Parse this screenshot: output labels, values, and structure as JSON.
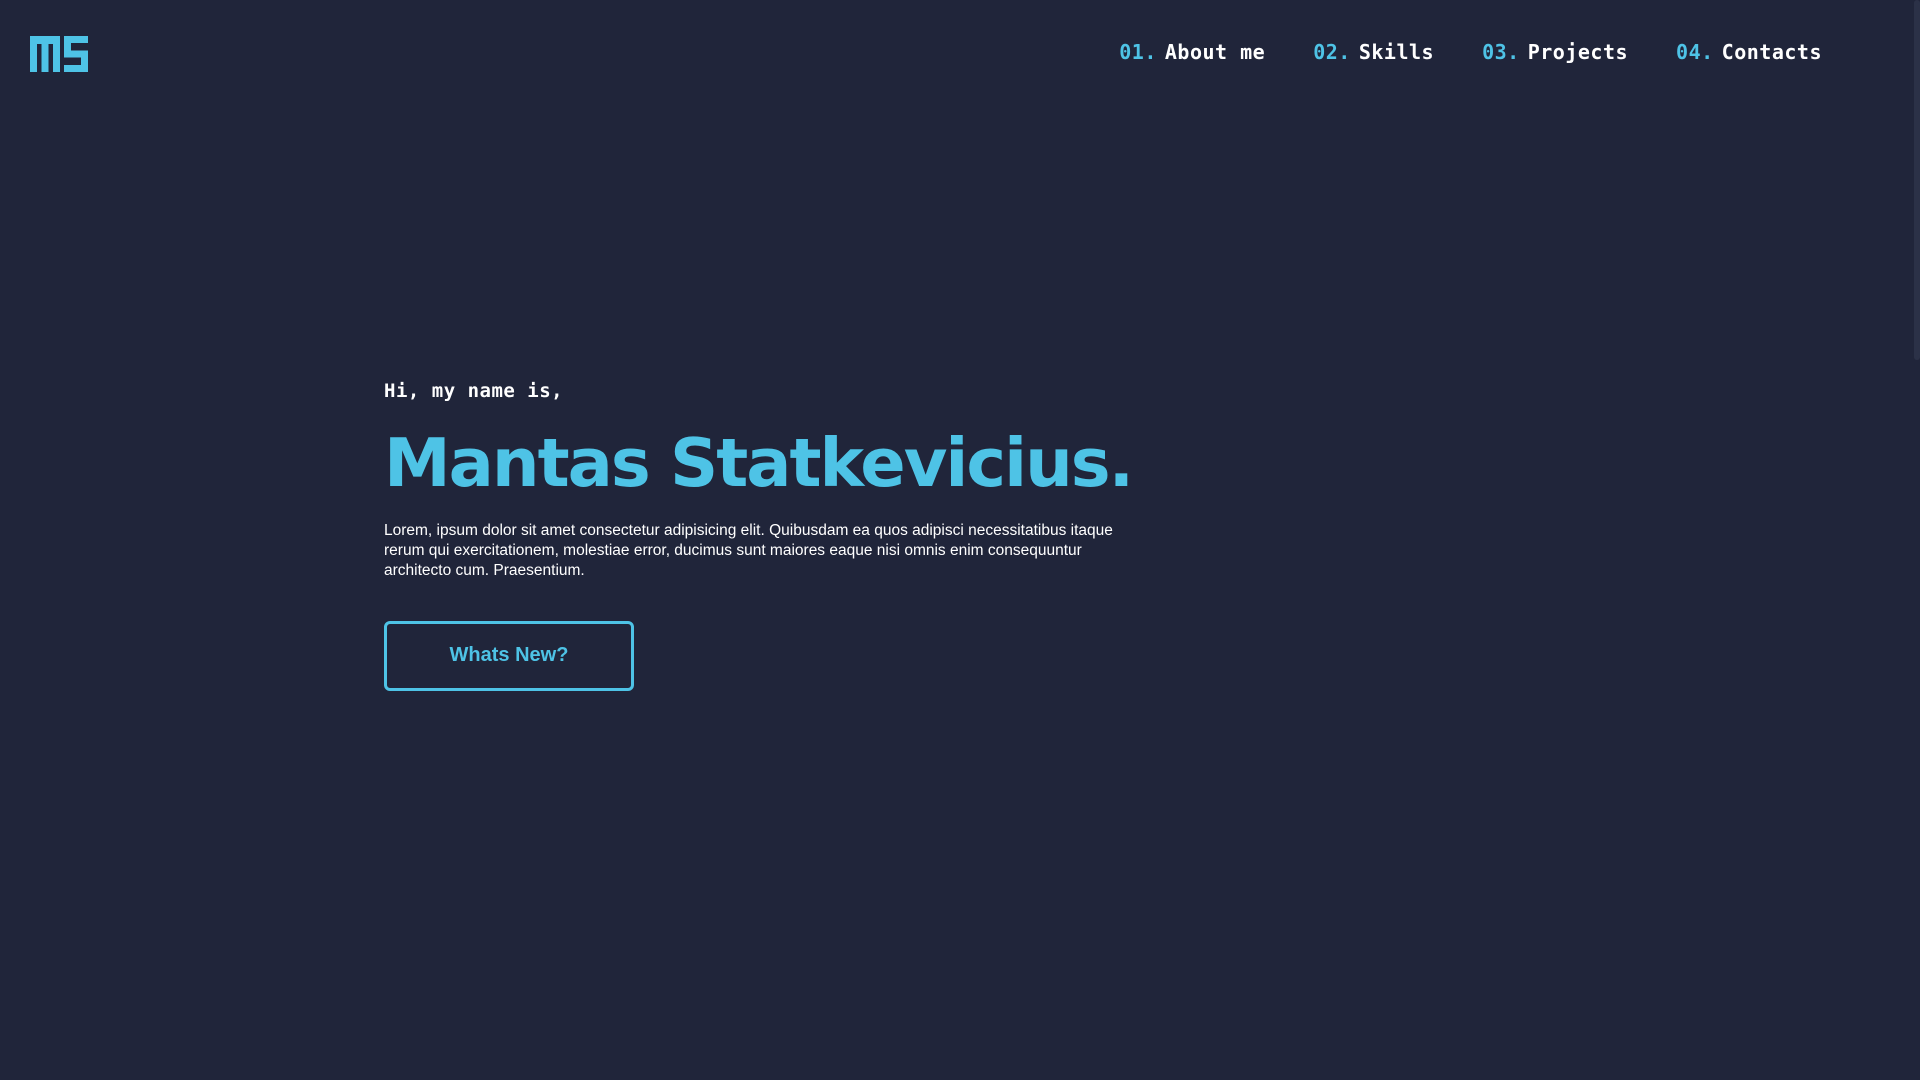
{
  "logo": {
    "icon": "ms-monogram-logo",
    "color": "#4ec3e6"
  },
  "nav": {
    "items": [
      {
        "num": "01.",
        "label": "About me"
      },
      {
        "num": "02.",
        "label": "Skills"
      },
      {
        "num": "03.",
        "label": "Projects"
      },
      {
        "num": "04.",
        "label": "Contacts"
      }
    ]
  },
  "hero": {
    "greeting": "Hi, my name is,",
    "name": "Mantas Statkevicius.",
    "bio": "Lorem, ipsum dolor sit amet consectetur adipisicing elit. Quibusdam ea quos adipisci necessitatibus itaque rerum qui exercitationem, molestiae error, ducimus sunt maiores eaque nisi omnis enim consequuntur architecto cum. Praesentium.",
    "cta_label": "Whats New?"
  },
  "colors": {
    "background": "#20253a",
    "accent": "#4ec3e6",
    "text": "#ffffff"
  }
}
